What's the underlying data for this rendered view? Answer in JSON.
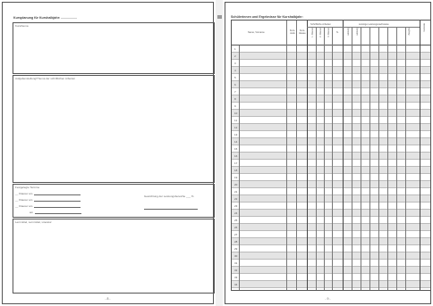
{
  "left_page": {
    "title": "Kursplanung für Kurshalbjahr: ..................",
    "boxes": {
      "topic_label": "Kursthema",
      "task_label": "Aufgabenstellung/Thema der schriftlichen Arbeiten",
      "dates_label": "Festgelegte Termine",
      "dates": [
        {
          "label": "__ Klausur am"
        },
        {
          "label": "__ Klausur am"
        },
        {
          "label": "__ Klausur am"
        },
        {
          "label": "am"
        }
      ],
      "weighting_label": "Gewichtung der Leistungsbereiche ___ %",
      "material_label": "Lernmittel, Lernmittel, Literatur"
    },
    "page_number": "- 8 -"
  },
  "right_page": {
    "title": "Schülerinnen und Ergebnisse für Kurshalbjahr:",
    "table": {
      "name_header": "Name, Vorname",
      "col2_header": "Kurs-stufe",
      "col3_header": "Kurs-klasse",
      "written_group_header": "Schriftliche Arbeiten",
      "written_subcols": [
        "1. Klausur",
        "2. Klausur",
        "3. Klausur",
        "N."
      ],
      "other_group_header": "sonstige Leistungsnachweise",
      "other_subcols": [
        "Leistung",
        "Leistung",
        "Zeugnis"
      ],
      "last_header": "Kursnote",
      "row_numbers": [
        "1",
        "2",
        "3",
        "4",
        "5",
        "6",
        "7",
        "8",
        "9",
        "10",
        "11",
        "12",
        "13",
        "14",
        "15",
        "16",
        "17",
        "18",
        "19",
        "20",
        "21",
        "22",
        "23",
        "24",
        "25",
        "26",
        "27",
        "28",
        "29",
        "30",
        "31",
        "32",
        "33",
        "34"
      ]
    },
    "page_number": "- 9 -"
  }
}
